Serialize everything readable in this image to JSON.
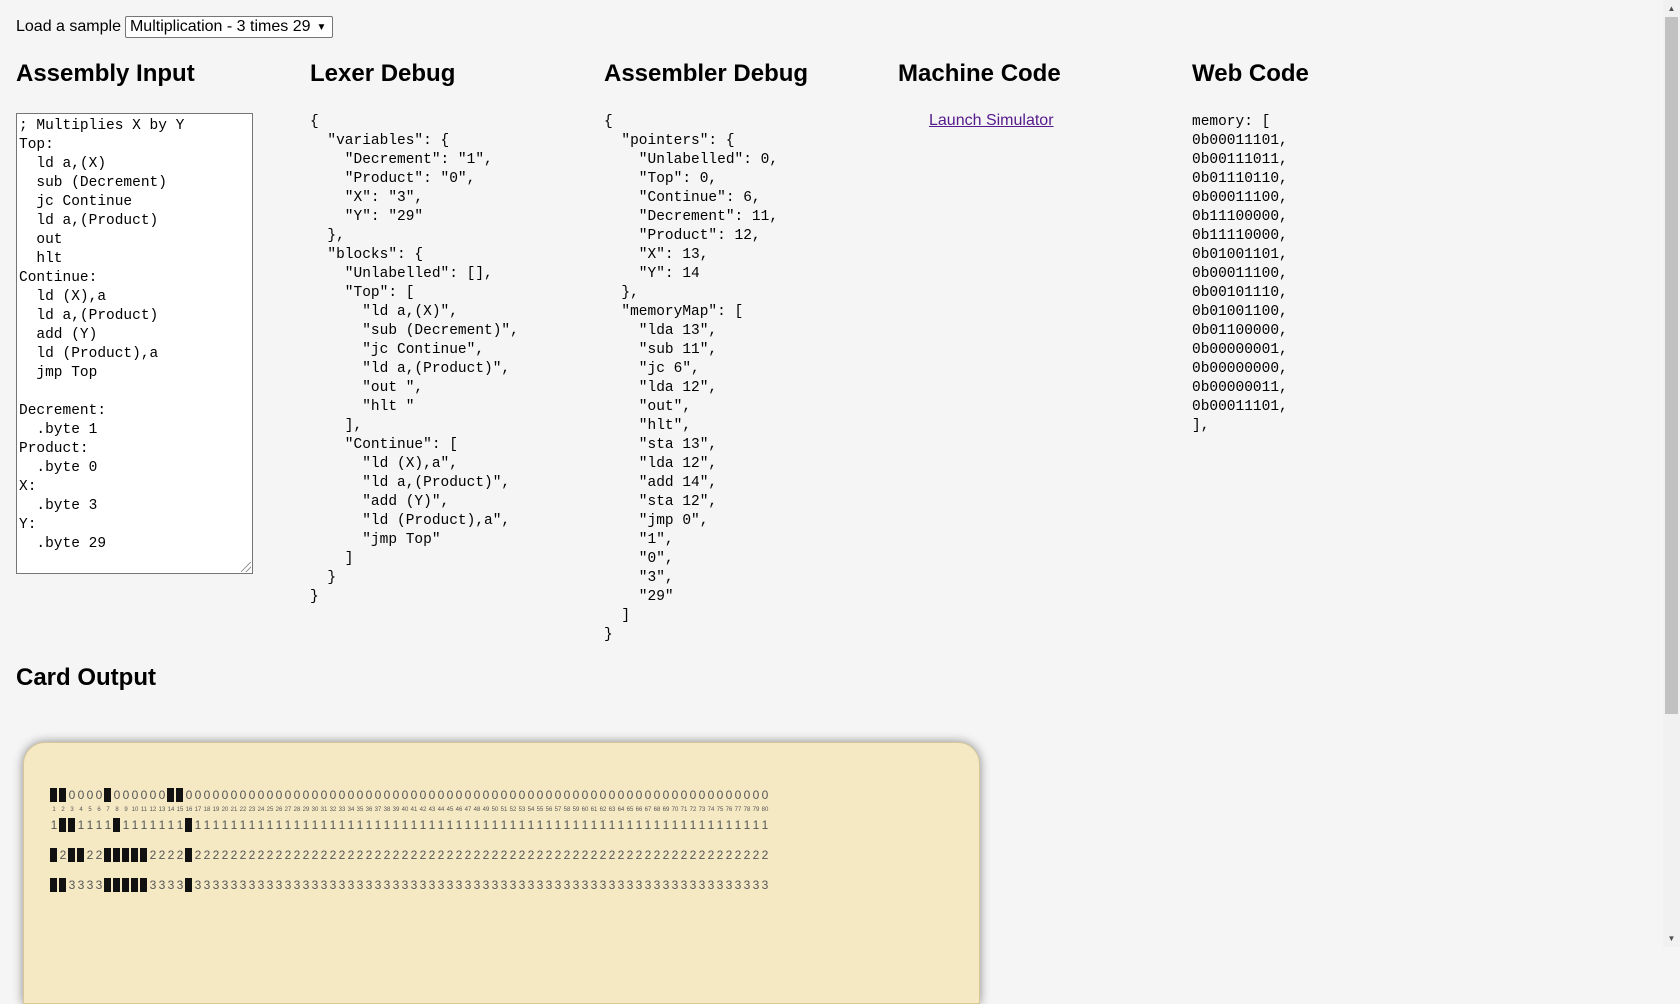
{
  "sample_picker": {
    "label": "Load a sample",
    "selected": "Multiplication - 3 times 29"
  },
  "columns": {
    "assembly_input": "Assembly Input",
    "lexer_debug": "Lexer Debug",
    "assembler_debug": "Assembler Debug",
    "machine_code": "Machine Code",
    "web_code": "Web Code"
  },
  "assembly_input_text": "; Multiplies X by Y\nTop:\n  ld a,(X)\n  sub (Decrement)\n  jc Continue\n  ld a,(Product)\n  out\n  hlt\nContinue:\n  ld (X),a\n  ld a,(Product)\n  add (Y)\n  ld (Product),a\n  jmp Top\n\nDecrement:\n  .byte 1\nProduct:\n  .byte 0\nX:\n  .byte 3\nY:\n  .byte 29",
  "lexer_debug_text": "{\n  \"variables\": {\n    \"Decrement\": \"1\",\n    \"Product\": \"0\",\n    \"X\": \"3\",\n    \"Y\": \"29\"\n  },\n  \"blocks\": {\n    \"Unlabelled\": [],\n    \"Top\": [\n      \"ld a,(X)\",\n      \"sub (Decrement)\",\n      \"jc Continue\",\n      \"ld a,(Product)\",\n      \"out \",\n      \"hlt \"\n    ],\n    \"Continue\": [\n      \"ld (X),a\",\n      \"ld a,(Product)\",\n      \"add (Y)\",\n      \"ld (Product),a\",\n      \"jmp Top\"\n    ]\n  }\n}",
  "assembler_debug_text": "{\n  \"pointers\": {\n    \"Unlabelled\": 0,\n    \"Top\": 0,\n    \"Continue\": 6,\n    \"Decrement\": 11,\n    \"Product\": 12,\n    \"X\": 13,\n    \"Y\": 14\n  },\n  \"memoryMap\": [\n    \"lda 13\",\n    \"sub 11\",\n    \"jc 6\",\n    \"lda 12\",\n    \"out\",\n    \"hlt\",\n    \"sta 13\",\n    \"lda 12\",\n    \"add 14\",\n    \"sta 12\",\n    \"jmp 0\",\n    \"1\",\n    \"0\",\n    \"3\",\n    \"29\"\n  ]\n}",
  "machine_code": {
    "launch_label": "Launch Simulator"
  },
  "web_code_text": "memory: [\n0b00011101,\n0b00111011,\n0b01110110,\n0b00011100,\n0b11100000,\n0b11110000,\n0b01001101,\n0b00011100,\n0b00101110,\n0b01001100,\n0b01100000,\n0b00000001,\n0b00000000,\n0b00000011,\n0b00011101,\n],",
  "card_output": {
    "title": "Card Output",
    "rows": [
      {
        "digit": "0",
        "punched": [
          1,
          2,
          7,
          14,
          15
        ]
      },
      {
        "digit": "1",
        "punched": [
          2,
          3,
          8,
          16
        ]
      },
      {
        "digit": "2",
        "punched": [
          1,
          3,
          4,
          7,
          8,
          9,
          10,
          11,
          16
        ]
      },
      {
        "digit": "3",
        "punched": [
          1,
          2,
          7,
          8,
          9,
          10,
          11,
          16
        ]
      }
    ],
    "columns": 80
  },
  "colors": {
    "page_bg": "#f5f5f5",
    "card_bg": "#f5e9c4",
    "link_visited": "#551a8b",
    "hole": "#111111"
  }
}
